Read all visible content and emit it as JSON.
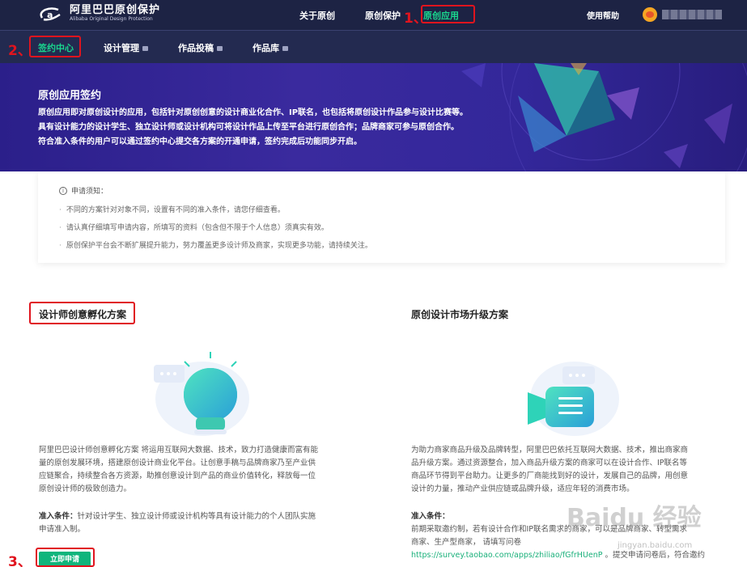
{
  "topbar": {
    "logo_cn": "阿里巴巴原创保护",
    "logo_en": "Alibaba Original Design Protection",
    "nav": [
      "关于原创",
      "原创保护",
      "原创应用"
    ],
    "help": "使用帮助",
    "annotation_marks": [
      "1、",
      "2、",
      "3、"
    ]
  },
  "subnav": {
    "items": [
      "签约中心",
      "设计管理",
      "作品投稿",
      "作品库"
    ]
  },
  "banner": {
    "title": "原创应用签约",
    "lines": [
      "原创应用即对原创设计的应用，包括针对原创创意的设计商业化合作、IP联名，也包括将原创设计作品参与设计比赛等。",
      "具有设计能力的设计学生、独立设计师或设计机构可将设计作品上传至平台进行原创合作；品牌商家可参与原创合作。",
      "符合准入条件的用户可以通过签约中心提交各方案的开通申请，签约完成后功能同步开启。"
    ]
  },
  "notice": {
    "heading": "申请须知：",
    "items": [
      "不同的方案针对对象不同，设置有不同的准入条件，请您仔细查看。",
      "请认真仔细填写申请内容，所填写的资料（包含但不限于个人信息）须真实有效。",
      "原创保护平台会不断扩展提升能力，努力覆盖更多设计师及商家，实现更多功能，请持续关注。"
    ]
  },
  "plan1": {
    "title": "设计师创意孵化方案",
    "desc": [
      "阿里巴巴设计师创意孵化方案 将运用互联网大数据、技术，致力打造健康而富有能",
      "量的原创发展环境，搭建原创设计商业化平台。让创意手稿与品牌商家乃至产业供",
      "应链聚合，持续整合各方资源，助推创意设计到产品的商业价值转化，释放每一位",
      "原创设计师的极致创造力。"
    ],
    "cond_label": "准入条件：",
    "cond_text": "针对设计学生、独立设计师或设计机构等具有设计能力的个人团队实施",
    "cond_text2": "申请准入制。",
    "button": "立即申请"
  },
  "plan2": {
    "title": "原创设计市场升级方案",
    "desc": [
      "为助力商家商品升级及品牌转型，阿里巴巴依托互联网大数据、技术，推出商家商",
      "品升级方案。通过资源整合，加入商品升级方案的商家可以在设计合作、IP联名等",
      "商品环节得到平台助力。让更多的厂商能找到好的设计，发展自己的品牌，用创意",
      "设计的力量，推动产业供应链或品牌升级，适应年轻的消费市场。"
    ],
    "cond_label": "准入条件：",
    "cond_lines": [
      "前期采取邀约制，若有设计合作和IP联名需求的商家，可以是品牌商家、转型需求",
      "商家、生产型商家，  请填写问卷"
    ],
    "link": "https://survey.taobao.com/apps/zhiliao/fGfrHUenP",
    "after_link": " 。提交申请问卷后，符合邀约"
  },
  "watermark": {
    "text": "Baidu 经验",
    "sub": "jingyan.baidu.com"
  }
}
